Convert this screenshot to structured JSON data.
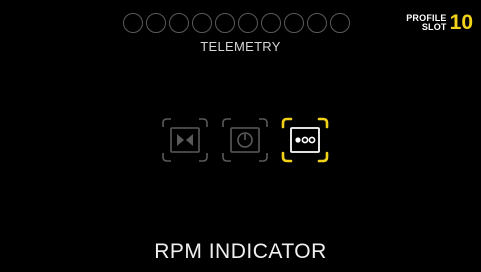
{
  "header": {
    "title": "TELEMETRY",
    "profile_slot": {
      "label_line1": "PROFILE",
      "label_line2": "SLOT",
      "number": "10"
    },
    "slot_dots_count": 10
  },
  "options": [
    {
      "icon": "shift-lights-icon",
      "selected": false
    },
    {
      "icon": "timer-icon",
      "selected": false
    },
    {
      "icon": "rpm-dots-icon",
      "selected": true
    }
  ],
  "selected_label": "RPM INDICATOR",
  "colors": {
    "accent": "#f3d21a",
    "inactive": "#5a5a5a",
    "background": "#000000",
    "text": "#f0f0f0"
  }
}
